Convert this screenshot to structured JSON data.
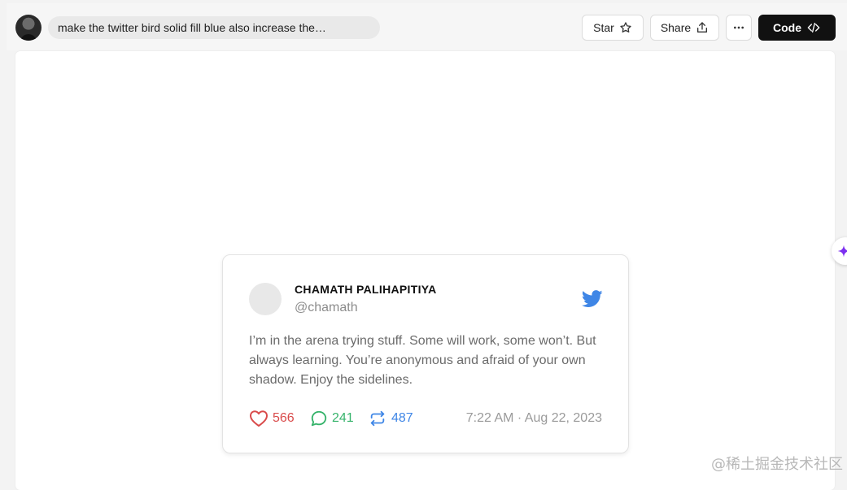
{
  "header": {
    "prompt_text": "make the twitter bird solid fill blue also increase the…",
    "star_label": "Star",
    "share_label": "Share",
    "code_label": "Code"
  },
  "tweet": {
    "author_name": "CHAMATH PALIHAPITIYA",
    "author_handle": "@chamath",
    "text": "I’m in the arena trying stuff. Some will work, some won’t. But always learning. You’re anonymous and afraid of your own shadow. Enjoy the sidelines.",
    "likes": "566",
    "replies": "241",
    "retweets": "487",
    "timestamp": "7:22 AM · Aug 22, 2023"
  },
  "watermark": "@稀土掘金技术社区",
  "icons": {
    "star": "star-icon",
    "share": "share-icon",
    "more": "more-icon",
    "code": "code-icon",
    "twitter": "twitter-bird-icon",
    "heart": "heart-icon",
    "reply": "reply-icon",
    "retweet": "retweet-icon",
    "sparkle": "sparkle-icon"
  },
  "colors": {
    "twitter_blue": "#3f86e6",
    "like_red": "#d94b4b",
    "reply_green": "#36b36b",
    "code_button": "#111111",
    "sparkle_purple": "#7c2ff0"
  }
}
